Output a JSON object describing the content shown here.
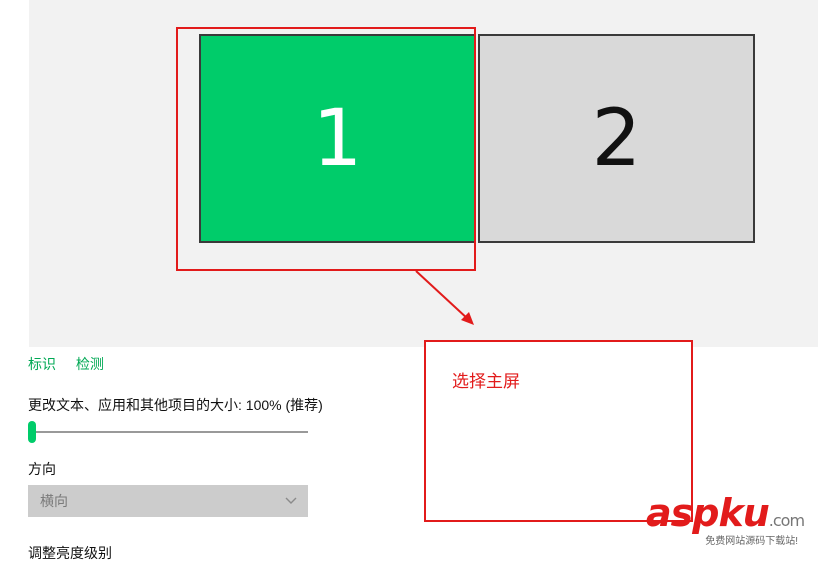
{
  "display": {
    "monitors": [
      {
        "number": "1",
        "state": "selected",
        "color": "#00cc6a"
      },
      {
        "number": "2",
        "state": "unselected",
        "color": "#d9d9d9"
      }
    ]
  },
  "actions": {
    "identify": "标识",
    "detect": "检测"
  },
  "scale": {
    "label": "更改文本、应用和其他项目的大小: 100% (推荐)",
    "slider_level": 0
  },
  "orientation": {
    "label": "方向",
    "selected": "横向"
  },
  "brightness": {
    "label": "调整亮度级别"
  },
  "annotation": {
    "callout_text": "选择主屏",
    "color": "#e21b1b"
  },
  "watermark": {
    "brand_a": "asp",
    "brand_b": "ku",
    "suffix": ".com",
    "tagline": "免费网站源码下载站!"
  },
  "colors": {
    "accent": "#00cc6a",
    "link": "#00a854"
  }
}
